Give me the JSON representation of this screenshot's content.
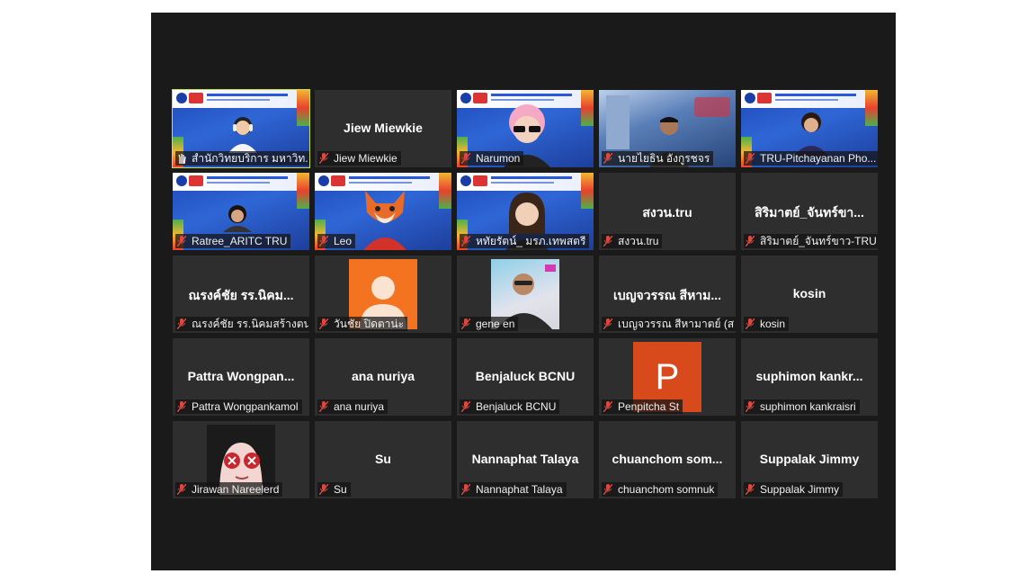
{
  "meeting": {
    "tiles": [
      {
        "label": "สำนักวิทยบริการ มหาวิท...",
        "kind": "slide",
        "active": true,
        "mic": "hand"
      },
      {
        "label": "Jiew Miewkie",
        "name": "Jiew Miewkie",
        "kind": "name"
      },
      {
        "label": "Narumon",
        "kind": "slide-memoji"
      },
      {
        "label": "นายไยธิน อังกูรชจร",
        "kind": "bg-city"
      },
      {
        "label": "TRU-Pitchayanan Pho...",
        "kind": "slide-woman"
      },
      {
        "label": "Ratree_ARITC TRU",
        "kind": "slide-small"
      },
      {
        "label": "Leo",
        "kind": "slide-fox"
      },
      {
        "label": "หทัยรัตน์_ มรภ.เทพสตรี",
        "kind": "slide-memoji2"
      },
      {
        "label": "สงวน.tru",
        "name": "สงวน.tru",
        "kind": "name"
      },
      {
        "label": "สิริมาตย์_จันทร์ขาว-TRU",
        "name": "สิริมาตย์_จันทร์ขา...",
        "kind": "name"
      },
      {
        "label": "ณรงค์ชัย รร.นิคมสร้างตน...",
        "name": "ณรงค์ชัย รร.นิคม...",
        "kind": "name"
      },
      {
        "label": "วันชัย ปิดตาน่ะ",
        "kind": "orange-avatar"
      },
      {
        "label": "gene en",
        "kind": "photo"
      },
      {
        "label": "เบญจวรรณ สีหามาตย์ (ส...",
        "name": "เบญจวรรณ สีหาม...",
        "kind": "name"
      },
      {
        "label": "kosin",
        "name": "kosin",
        "kind": "name"
      },
      {
        "label": "Pattra Wongpankamol",
        "name": "Pattra  Wongpan...",
        "kind": "name"
      },
      {
        "label": "ana nuriya",
        "name": "ana nuriya",
        "kind": "name"
      },
      {
        "label": "Benjaluck BCNU",
        "name": "Benjaluck BCNU",
        "kind": "name"
      },
      {
        "label": "Penpitcha St",
        "letter": "P",
        "kind": "letter"
      },
      {
        "label": "suphimon kankraisri",
        "name": "suphimon  kankr...",
        "kind": "name"
      },
      {
        "label": "Jirawan Nareelerd",
        "kind": "anime"
      },
      {
        "label": "Su",
        "name": "Su",
        "kind": "name"
      },
      {
        "label": "Nannaphat Talaya",
        "name": "Nannaphat Talaya",
        "kind": "name"
      },
      {
        "label": "chuanchom somnuk",
        "name": "chuanchom  som...",
        "kind": "name"
      },
      {
        "label": "Suppalak Jimmy",
        "name": "Suppalak Jimmy",
        "kind": "name"
      }
    ]
  },
  "colors": {
    "window_bg": "#1a1a1a",
    "tile_bg": "#2e2e2e",
    "active_border": "#c9e04a",
    "muted_mic": "#e0463c",
    "orange_avatar": "#f37320",
    "letter_avatar": "#d84a1b"
  },
  "icons": {
    "mic": "mic-muted-icon",
    "hand": "raise-hand-icon"
  }
}
